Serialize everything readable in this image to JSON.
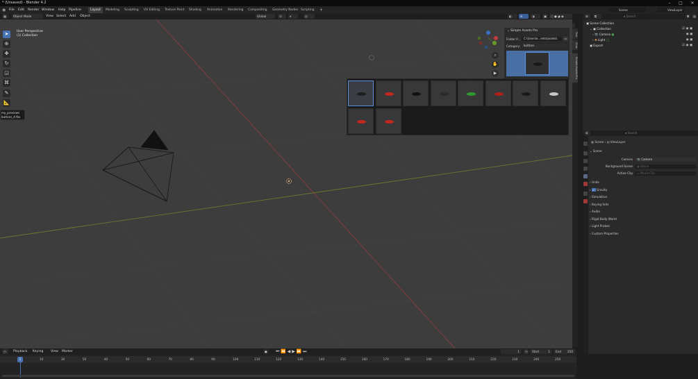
{
  "window": {
    "title": "* (Unsaved) - Blender 4.2"
  },
  "menus": [
    "File",
    "Edit",
    "Render",
    "Window",
    "Help",
    "Pipeline"
  ],
  "workspaces": [
    "Layout",
    "Modeling",
    "Sculpting",
    "UV Editing",
    "Texture Paint",
    "Shading",
    "Animation",
    "Rendering",
    "Compositing",
    "Geometry Nodes",
    "Scripting"
  ],
  "active_workspace": "Layout",
  "topbar_right": {
    "scene_label": "Scene",
    "viewlayer_label": "ViewLayer"
  },
  "viewport_header": {
    "mode": "Object Mode",
    "menus": [
      "View",
      "Select",
      "Add",
      "Object"
    ],
    "orientation": "Global",
    "options_label": "Options"
  },
  "viewport": {
    "perspective": "User Perspective",
    "collection": "(1) Collection"
  },
  "side_tabs": [
    "Tool",
    "View",
    "Simple Assets Pro"
  ],
  "assets_panel": {
    "title": "Simple Assets Pro",
    "folder_label": "Folder P...",
    "folder_value": "C:\\Users\\e...ents\\assets\\",
    "category_label": "Category:",
    "category_value": "buttons"
  },
  "tooltip": {
    "line1": "my_previews",
    "line2": "buttons_4.fbx"
  },
  "outliner": {
    "search_placeholder": "Search",
    "rows": [
      {
        "label": "Scene Collection"
      },
      {
        "label": "Collection"
      },
      {
        "label": "Camera"
      },
      {
        "label": "Light"
      },
      {
        "label": "Export"
      }
    ]
  },
  "properties": {
    "search_placeholder": "Search",
    "breadcrumb_scene": "Scene",
    "breadcrumb_viewlayer": "ViewLayer",
    "scene_section": "Scene",
    "camera_label": "Camera",
    "camera_value": "Camera",
    "bg_scene_label": "Background Scene",
    "bg_scene_value": "Scene",
    "active_clip_label": "Active Clip",
    "active_clip_value": "Movie Clip",
    "sections": [
      "Units",
      "Gravity",
      "Simulation",
      "Keying Sets",
      "Audio",
      "Rigid Body World",
      "Light Probes",
      "Custom Properties"
    ]
  },
  "timeline": {
    "menus": [
      "Playback",
      "Keying",
      "View",
      "Marker"
    ],
    "current_frame": "1",
    "start_label": "Start",
    "start_value": "1",
    "end_label": "End",
    "end_value": "250",
    "ticks": [
      "1",
      "10",
      "30",
      "50",
      "40",
      "50",
      "60",
      "70",
      "80",
      "90",
      "100",
      "110",
      "120",
      "130",
      "140",
      "150",
      "160",
      "170",
      "180",
      "190",
      "200",
      "210",
      "220",
      "230",
      "240",
      "250"
    ]
  },
  "thumbnails": [
    {
      "color": "#1e1e1e",
      "selected": true
    },
    {
      "color": "#c0281e"
    },
    {
      "color": "#121212"
    },
    {
      "color": "#2a2a2a"
    },
    {
      "color": "#2e9a2e"
    },
    {
      "color": "#b0201a"
    },
    {
      "color": "#1a1a1a"
    },
    {
      "color": "#c8c8c8"
    },
    {
      "color": "#c0281e"
    },
    {
      "color": "#c0281e"
    }
  ]
}
